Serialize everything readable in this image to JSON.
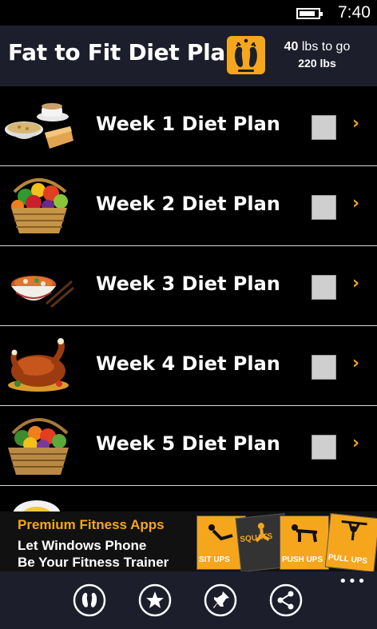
{
  "status_bar": {
    "time": "7:40"
  },
  "header": {
    "title": "Fat to Fit Diet Plan",
    "weight_togo_value": "40",
    "weight_togo_text": " lbs to go",
    "current_weight": "220 lbs",
    "badge_icon": "feet-icon",
    "accent_color": "#f6a61c"
  },
  "plans": [
    {
      "label": "Week 1 Diet Plan",
      "icon": "breakfast-icon",
      "checked": false
    },
    {
      "label": "Week 2 Diet Plan",
      "icon": "fruit-basket-icon",
      "checked": false
    },
    {
      "label": "Week 3 Diet Plan",
      "icon": "noodle-bowl-icon",
      "checked": false
    },
    {
      "label": "Week 4 Diet Plan",
      "icon": "roast-chicken-icon",
      "checked": false
    },
    {
      "label": "Week 5 Diet Plan",
      "icon": "vegetable-basket-icon",
      "checked": false
    }
  ],
  "ad": {
    "heading": "Premium Fitness Apps",
    "line1": "Let Windows Phone",
    "line2": "Be Your Fitness Trainer",
    "tiles": [
      "SIT UPS",
      "SQUATS",
      "PUSH UPS",
      "PULL UPS"
    ]
  },
  "app_bar": {
    "buttons": [
      "feet-icon",
      "star-icon",
      "pin-icon",
      "share-icon"
    ],
    "more_label": "•••"
  }
}
